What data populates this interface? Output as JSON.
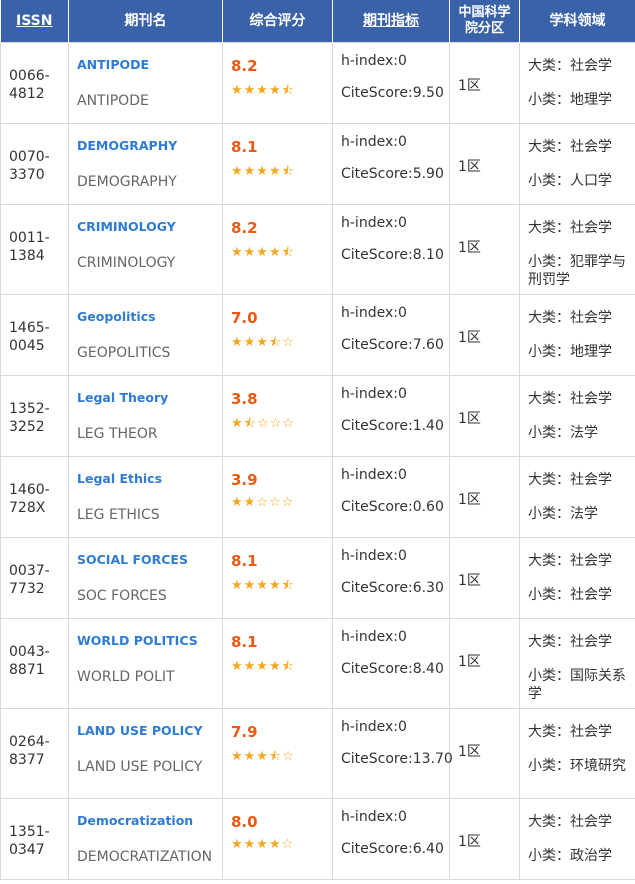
{
  "header": {
    "issn": "ISSN",
    "name": "期刊名",
    "score": "综合评分",
    "metrics": "期刊指标",
    "zone": "中国科学院分区",
    "field": "学科领域"
  },
  "rows": [
    {
      "issn": "0066-4812",
      "name": "ANTIPODE",
      "abbr": "ANTIPODE",
      "score": "8.2",
      "stars": "★★★★⯪",
      "hindex": "h-index:0",
      "citescore": "CiteScore:9.50",
      "zone": "1区",
      "major": "大类：社会学",
      "minor": "小类：地理学"
    },
    {
      "issn": "0070-3370",
      "name": "DEMOGRAPHY",
      "abbr": "DEMOGRAPHY",
      "score": "8.1",
      "stars": "★★★★⯪",
      "hindex": "h-index:0",
      "citescore": "CiteScore:5.90",
      "zone": "1区",
      "major": "大类：社会学",
      "minor": "小类：人口学"
    },
    {
      "issn": "0011-1384",
      "name": "CRIMINOLOGY",
      "abbr": "CRIMINOLOGY",
      "score": "8.2",
      "stars": "★★★★⯪",
      "hindex": "h-index:0",
      "citescore": "CiteScore:8.10",
      "zone": "1区",
      "major": "大类：社会学",
      "minor": "小类：犯罪学与刑罚学"
    },
    {
      "issn": "1465-0045",
      "name": "Geopolitics",
      "abbr": "GEOPOLITICS",
      "score": "7.0",
      "stars": "★★★⯪☆",
      "hindex": "h-index:0",
      "citescore": "CiteScore:7.60",
      "zone": "1区",
      "major": "大类：社会学",
      "minor": "小类：地理学"
    },
    {
      "issn": "1352-3252",
      "name": "Legal Theory",
      "abbr": "LEG THEOR",
      "score": "3.8",
      "stars": "★⯪☆☆☆",
      "hindex": "h-index:0",
      "citescore": "CiteScore:1.40",
      "zone": "1区",
      "major": "大类：社会学",
      "minor": "小类：法学"
    },
    {
      "issn": "1460-728X",
      "name": "Legal Ethics",
      "abbr": "LEG ETHICS",
      "score": "3.9",
      "stars": "★★☆☆☆",
      "hindex": "h-index:0",
      "citescore": "CiteScore:0.60",
      "zone": "1区",
      "major": "大类：社会学",
      "minor": "小类：法学"
    },
    {
      "issn": "0037-7732",
      "name": "SOCIAL FORCES",
      "abbr": "SOC FORCES",
      "score": "8.1",
      "stars": "★★★★⯪",
      "hindex": "h-index:0",
      "citescore": "CiteScore:6.30",
      "zone": "1区",
      "major": "大类：社会学",
      "minor": "小类：社会学"
    },
    {
      "issn": "0043-8871",
      "name": "WORLD POLITICS",
      "abbr": "WORLD POLIT",
      "score": "8.1",
      "stars": "★★★★⯪",
      "hindex": "h-index:0",
      "citescore": "CiteScore:8.40",
      "zone": "1区",
      "major": "大类：社会学",
      "minor": "小类：国际关系学"
    },
    {
      "issn": "0264-8377",
      "name": "LAND USE POLICY",
      "abbr": "LAND USE POLICY",
      "score": "7.9",
      "stars": "★★★⯪☆",
      "hindex": "h-index:0",
      "citescore": "CiteScore:13.70",
      "zone": "1区",
      "major": "大类：社会学",
      "minor": "小类：环境研究"
    },
    {
      "issn": "1351-0347",
      "name": "Democratization",
      "abbr": "DEMOCRATIZATION",
      "score": "8.0",
      "stars": "★★★★☆",
      "hindex": "h-index:0",
      "citescore": "CiteScore:6.40",
      "zone": "1区",
      "major": "大类：社会学",
      "minor": "小类：政治学"
    }
  ]
}
